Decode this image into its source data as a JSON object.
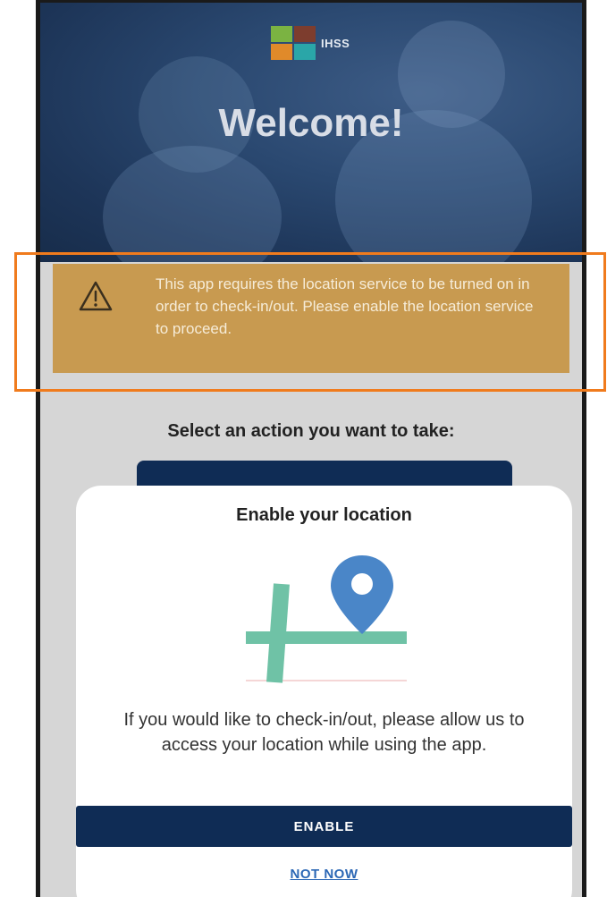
{
  "header": {
    "logo_text": "IHSS",
    "title": "Welcome!"
  },
  "alert": {
    "icon": "warning-triangle-icon",
    "message": "This app requires the location service to be turned on in order to check-in/out. Please enable the location service to proceed."
  },
  "main": {
    "prompt": "Select an action you want to take:"
  },
  "modal": {
    "title": "Enable your location",
    "illustration": "map-pin-icon",
    "body": "If you would like to check-in/out, please allow us to access your location while using the app.",
    "enable_label": "ENABLE",
    "not_now_label": "NOT NOW"
  },
  "colors": {
    "brand_navy": "#0f2c55",
    "warning_bg": "#c89a50",
    "highlight_orange": "#f07b1d",
    "link_blue": "#2b67b5",
    "pin_blue": "#4a86c8",
    "road_green": "#6fc2a6"
  }
}
